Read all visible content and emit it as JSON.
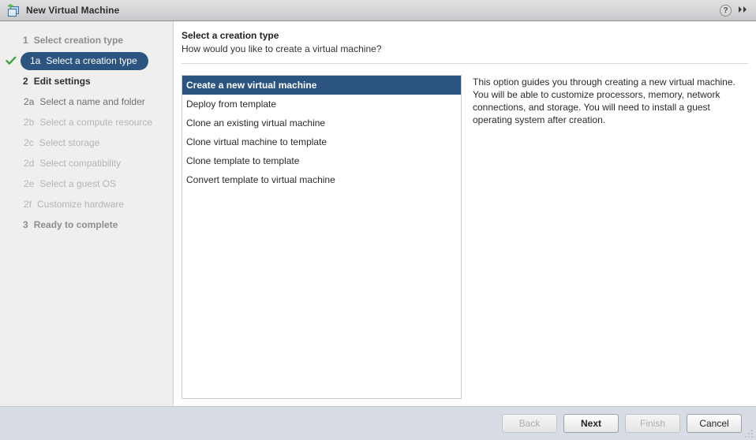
{
  "window": {
    "title": "New Virtual Machine",
    "icon": "new-virtual-machine-icon",
    "help_label": "?",
    "expand_label": "▸▸"
  },
  "colors": {
    "accent": "#2b5480",
    "check": "#3aa33a",
    "titlebar": "#d6d6d9",
    "sidebar": "#efefee",
    "footer": "#d8dce4"
  },
  "sidebar": {
    "items": [
      {
        "num": "1",
        "label": "Select creation type",
        "level": 1,
        "state": "done"
      },
      {
        "num": "1a",
        "label": "Select a creation type",
        "level": 2,
        "state": "active"
      },
      {
        "num": "2",
        "label": "Edit settings",
        "level": 1,
        "state": "current"
      },
      {
        "num": "2a",
        "label": "Select a name and folder",
        "level": 2,
        "state": "next"
      },
      {
        "num": "2b",
        "label": "Select a compute resource",
        "level": 2,
        "state": "upcoming"
      },
      {
        "num": "2c",
        "label": "Select storage",
        "level": 2,
        "state": "upcoming"
      },
      {
        "num": "2d",
        "label": "Select compatibility",
        "level": 2,
        "state": "upcoming"
      },
      {
        "num": "2e",
        "label": "Select a guest OS",
        "level": 2,
        "state": "upcoming"
      },
      {
        "num": "2f",
        "label": "Customize hardware",
        "level": 2,
        "state": "upcoming"
      },
      {
        "num": "3",
        "label": "Ready to complete",
        "level": 1,
        "state": "upcoming"
      }
    ]
  },
  "content": {
    "title": "Select a creation type",
    "subtitle": "How would you like to create a virtual machine?",
    "options": [
      {
        "label": "Create a new virtual machine",
        "selected": true
      },
      {
        "label": "Deploy from template",
        "selected": false
      },
      {
        "label": "Clone an existing virtual machine",
        "selected": false
      },
      {
        "label": "Clone virtual machine to template",
        "selected": false
      },
      {
        "label": "Clone template to template",
        "selected": false
      },
      {
        "label": "Convert template to virtual machine",
        "selected": false
      }
    ],
    "description": "This option guides you through creating a new virtual machine. You will be able to customize processors, memory, network connections, and storage. You will need to install a guest operating system after creation."
  },
  "footer": {
    "buttons": [
      {
        "label": "Back",
        "state": "disabled"
      },
      {
        "label": "Next",
        "state": "default"
      },
      {
        "label": "Finish",
        "state": "disabled"
      },
      {
        "label": "Cancel",
        "state": "enabled"
      }
    ]
  }
}
